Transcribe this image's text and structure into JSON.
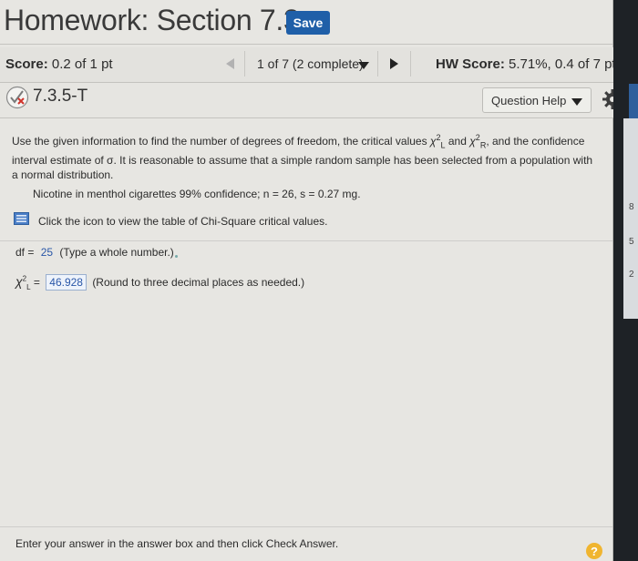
{
  "header": {
    "title": "Homework: Section 7.3",
    "save_label": "Save"
  },
  "score_bar": {
    "score_label": "Score:",
    "score_value": "0.2 of 1 pt",
    "progress": "1 of 7 (2 complete)",
    "hw_score_label": "HW Score:",
    "hw_score_value": "5.71%, 0.4 of 7 pts"
  },
  "question": {
    "id": "7.3.5-T",
    "help_label": "Question Help"
  },
  "problem": {
    "text_1": "Use the given information to find the number of degrees of freedom, the critical values",
    "chi_L": "χ",
    "and": "and",
    "chi_R": "χ",
    "text_2": ", and the confidence interval estimate of σ. It is reasonable to assume that a simple random sample has been selected from a population with a normal distribution.",
    "givens": "Nicotine in menthol cigarettes 99% confidence; n = 26, s = 0.27 mg.",
    "table_link": "Click the icon to view the table of Chi-Square critical values."
  },
  "answers": {
    "df_label": "df =",
    "df_value": "25",
    "df_hint": "(Type a whole number.)",
    "chi_label": "χ",
    "chi_sub": "L",
    "chi_sup": "2",
    "chi_value": "46.928",
    "chi_hint": "(Round to three decimal places as needed.)"
  },
  "footer": {
    "instruction": "Enter your answer in the answer box and then click Check Answer.",
    "help_glyph": "?"
  },
  "side_strip": [
    "8",
    "5",
    "2"
  ],
  "colors": {
    "save_button": "#1f5fa8",
    "answer_blue": "#2a57a8",
    "help_yellow": "#f0b530",
    "wrong_red": "#d0342c"
  }
}
